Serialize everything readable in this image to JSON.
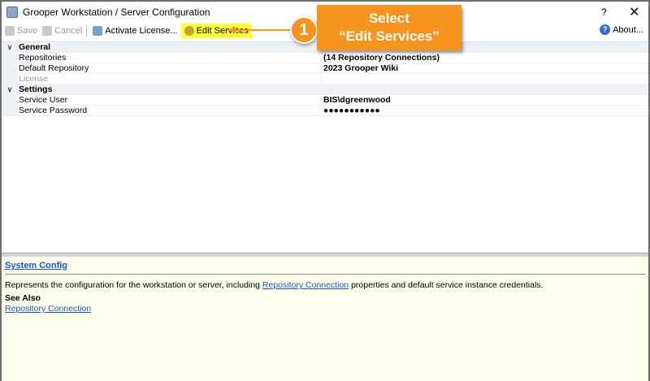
{
  "window": {
    "title": "Grooper Workstation / Server Configuration",
    "help": "?",
    "close": "✕"
  },
  "toolbar": {
    "save": "Save",
    "cancel": "Cancel",
    "activate": "Activate License...",
    "edit": "Edit Services",
    "about": "About..."
  },
  "grid": {
    "general": "General",
    "settings": "Settings",
    "rows": [
      {
        "name": "Repositories",
        "value": "(14 Repository Connections)"
      },
      {
        "name": "Default Repository",
        "value": "2023 Grooper Wiki"
      },
      {
        "name": "License",
        "value": ""
      },
      {
        "name": "Service User",
        "value": "BIS\\dgreenwood"
      },
      {
        "name": "Service Password",
        "value": "●●●●●●●●●●●"
      }
    ]
  },
  "help": {
    "title": "System Config",
    "desc_before": "Represents the configuration for the workstation or server, including ",
    "desc_link": "Repository Connection",
    "desc_after": " properties and default service instance credentials.",
    "see_also": "See Also",
    "see_link": "Repository Connection"
  },
  "callout": {
    "number": "1",
    "line1": "Select",
    "line2": "“Edit Services”",
    "color": "#f7941d"
  }
}
